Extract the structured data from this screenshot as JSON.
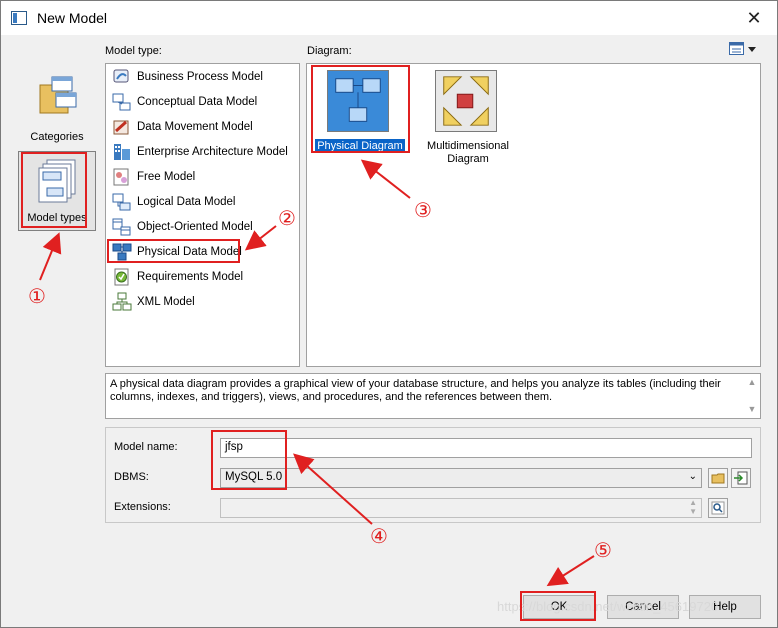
{
  "window": {
    "title": "New Model",
    "close_glyph": "✕"
  },
  "categories": [
    {
      "label": "Categories",
      "icon": "categories-icon"
    },
    {
      "label": "Model types",
      "icon": "model-types-icon",
      "selected": true
    }
  ],
  "model_type": {
    "label": "Model type:",
    "items": [
      {
        "label": "Business Process Model",
        "icon": "business-process-icon"
      },
      {
        "label": "Conceptual Data Model",
        "icon": "conceptual-data-icon"
      },
      {
        "label": "Data Movement Model",
        "icon": "data-movement-icon"
      },
      {
        "label": "Enterprise Architecture Model",
        "icon": "enterprise-architecture-icon"
      },
      {
        "label": "Free Model",
        "icon": "free-model-icon"
      },
      {
        "label": "Logical Data Model",
        "icon": "logical-data-icon"
      },
      {
        "label": "Object-Oriented Model",
        "icon": "object-oriented-icon"
      },
      {
        "label": "Physical Data Model",
        "icon": "physical-data-icon",
        "selected": true
      },
      {
        "label": "Requirements Model",
        "icon": "requirements-icon"
      },
      {
        "label": "XML Model",
        "icon": "xml-model-icon"
      }
    ]
  },
  "diagram": {
    "label": "Diagram:",
    "view_icon": "view-list-icon",
    "items": [
      {
        "label": "Physical Diagram",
        "icon": "physical-diagram-icon",
        "selected": true
      },
      {
        "label_line1": "Multidimensional",
        "label_line2": "Diagram",
        "icon": "multidimensional-diagram-icon"
      }
    ]
  },
  "description": "A physical data diagram provides a graphical view of your database structure, and helps you analyze its tables (including their columns, indexes, and triggers), views, and procedures, and the references between them.",
  "form": {
    "model_name_label": "Model name:",
    "model_name_value": "jfsp",
    "dbms_label": "DBMS:",
    "dbms_value": "MySQL 5.0",
    "extensions_label": "Extensions:",
    "extensions_value": ""
  },
  "buttons": {
    "ok": "OK",
    "cancel": "Cancel",
    "help": "Help"
  },
  "annotations": {
    "n1": "①",
    "n2": "②",
    "n3": "③",
    "n4": "④",
    "n5": "⑤",
    "color": "#e02020"
  },
  "watermark": "https://blog.csdn.net/weixin_45619720"
}
